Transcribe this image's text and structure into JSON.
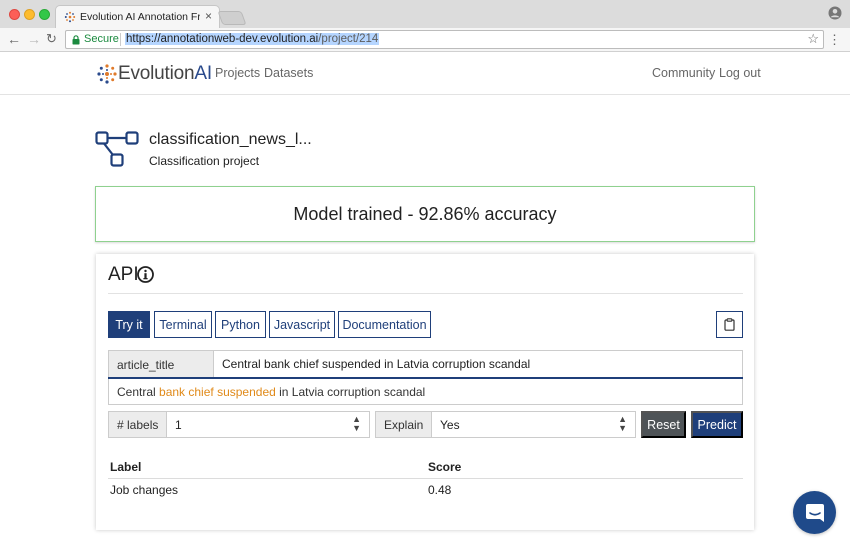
{
  "browser": {
    "tab_title": "Evolution AI Annotation Frame",
    "tab_close": "×",
    "secure_label": "Secure",
    "url_base": "https://annotationweb-dev.evolution.ai",
    "url_path": "/project/214",
    "icons": [
      "back-icon",
      "forward-icon",
      "reload-icon",
      "lock-icon",
      "star-icon",
      "menu-icon",
      "profile-icon"
    ]
  },
  "nav": {
    "brand_prefix": "Evolution",
    "brand_suffix": "AI",
    "links": [
      "Projects",
      "Datasets"
    ],
    "right_links": [
      "Community",
      "Log out"
    ]
  },
  "project": {
    "title": "classification_news_l...",
    "subtitle": "Classification project"
  },
  "status": {
    "text": "Model trained - 92.86% accuracy",
    "border_color": "#8fd18f"
  },
  "api": {
    "title": "API",
    "tabs": [
      "Try it",
      "Terminal",
      "Python",
      "Javascript",
      "Documentation"
    ],
    "active_tab": "Try it",
    "input_label": "article_title",
    "input_value": "Central bank chief suspended in Latvia corruption scandal",
    "highlight": {
      "before": "Central ",
      "highlighted": "bank chief suspended",
      "after": " in Latvia corruption scandal",
      "color": "#e08a1a"
    },
    "labels_label": "# labels",
    "labels_value": "1",
    "explain_label": "Explain",
    "explain_value": "Yes",
    "reset_label": "Reset",
    "predict_label": "Predict",
    "accent_color": "#1f3f7a"
  },
  "results": {
    "headers": [
      "Label",
      "Score"
    ],
    "rows": [
      {
        "label": "Job changes",
        "score": "0.48"
      }
    ]
  }
}
